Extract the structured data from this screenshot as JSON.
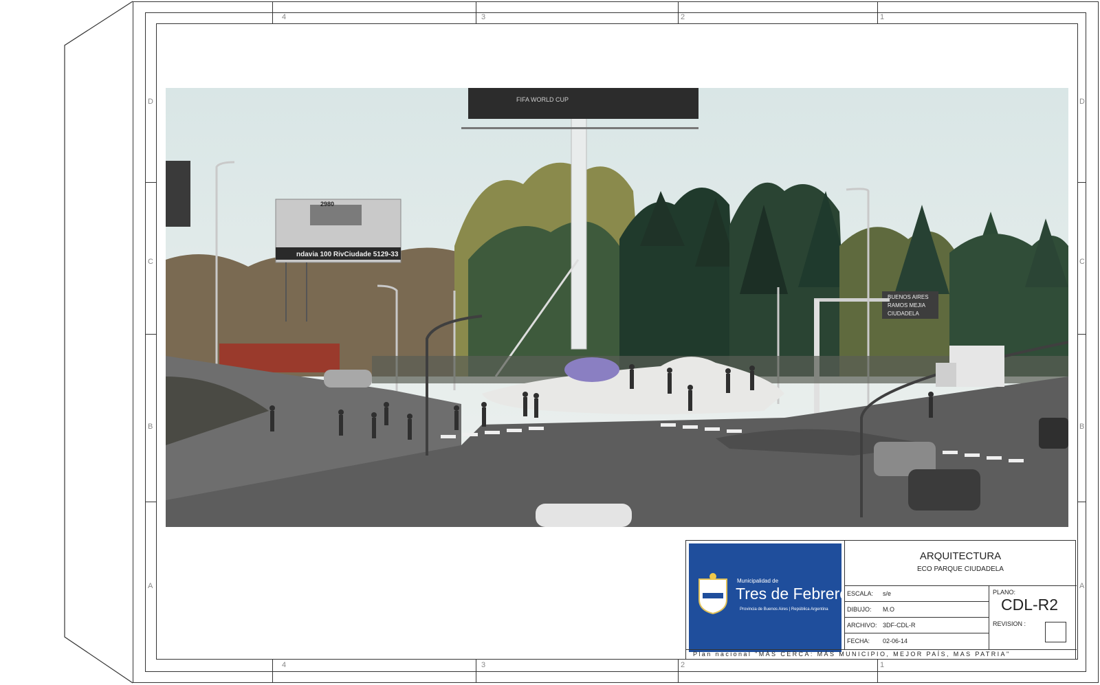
{
  "sheet": {
    "columns": [
      "4",
      "3",
      "2",
      "1"
    ],
    "rows": [
      "D",
      "C",
      "B",
      "A"
    ]
  },
  "billboards": {
    "main_text": "FIFA WORLD CUP",
    "left_text": "ndavia 100  RivCiudade 5129-33",
    "left_top_text": "2980"
  },
  "road_sign": {
    "lines": [
      "BUENOS AIRES",
      "RAMOS MEJIA",
      "CIUDADELA"
    ]
  },
  "title_block": {
    "logo": {
      "municipality_label": "Municipalidad de",
      "name": "Tres de Febrero",
      "subtitle": "Provincia de Buenos Aires | República Argentina"
    },
    "department": "ARQUITECTURA",
    "project": "ECO PARQUE CIUDADELA",
    "fields": [
      {
        "label": "ESCALA:",
        "value": "s/e"
      },
      {
        "label": "DIBUJO:",
        "value": "M.O"
      },
      {
        "label": "ARCHIVO:",
        "value": "3DF-CDL-R"
      },
      {
        "label": "FECHA:",
        "value": "02-06-14"
      }
    ],
    "plano_label": "PLANO:",
    "plano_value": "CDL-R2",
    "revision_label": "REVISION :",
    "footer": "Plan nacional \"MÁS CERCA: MÁS MUNICIPIO, MEJOR PAÍS, MAS PATRIA\""
  },
  "colors": {
    "logo_blue": "#1f4e9c",
    "sky": "#dfe6e6",
    "foliage_dark": "#2f4a38",
    "foliage_light": "#8a8a4c",
    "road": "#5d5d5d"
  }
}
